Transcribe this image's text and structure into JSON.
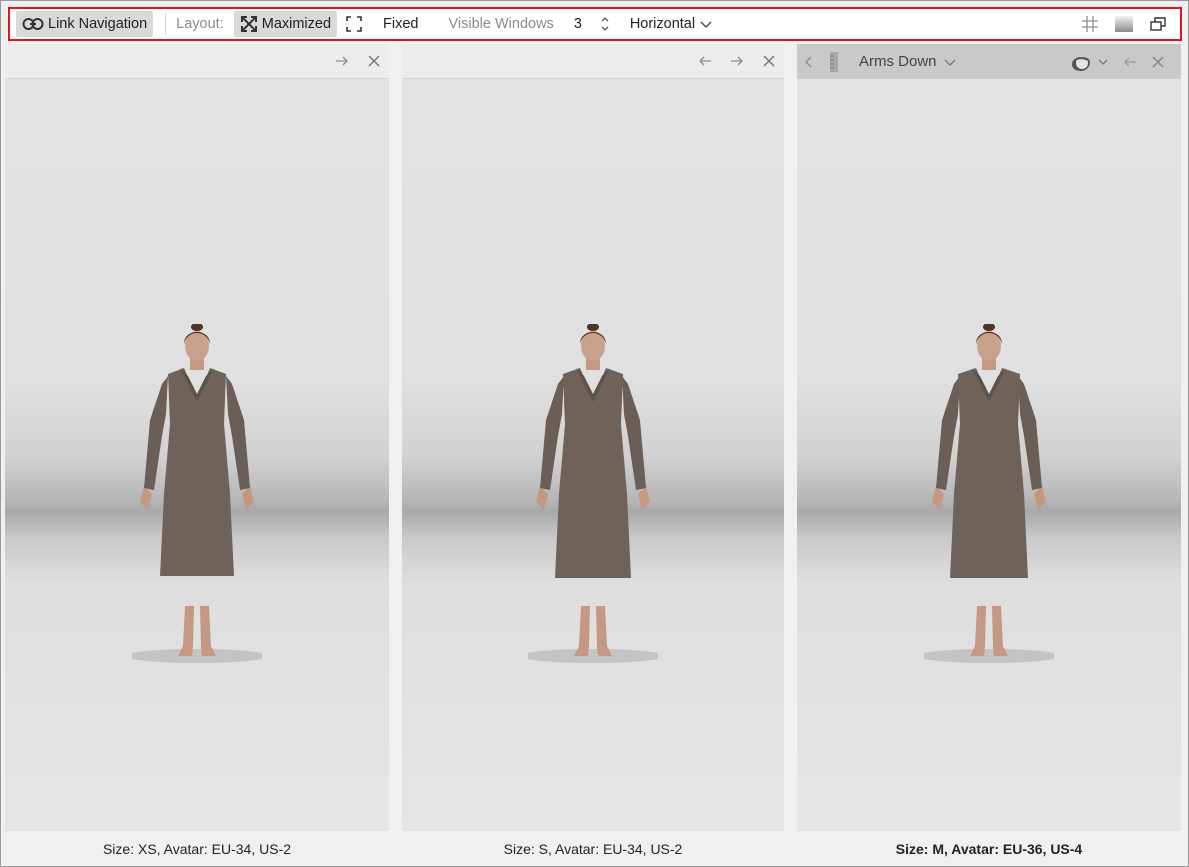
{
  "toolbar": {
    "link_navigation": "Link Navigation",
    "layout_label": "Layout:",
    "maximized": "Maximized",
    "fixed": "Fixed",
    "visible_windows_label": "Visible Windows",
    "visible_windows_value": "3",
    "orientation": "Horizontal",
    "icons": [
      "link-icon",
      "maximize-icon",
      "fixed-frame-icon",
      "stepper-icon",
      "chevron-down-icon",
      "grid-icon",
      "background-icon",
      "restore-window-icon"
    ]
  },
  "panels": [
    {
      "caption": "Size: XS, Avatar: EU-34, US-2",
      "header_icons": [
        "arrow-right-icon",
        "close-icon"
      ]
    },
    {
      "caption": "Size: S, Avatar: EU-34, US-2",
      "header_icons": [
        "arrow-left-icon",
        "arrow-right-icon",
        "close-icon"
      ]
    },
    {
      "caption": "Size: M, Avatar: EU-36, US-4",
      "pose": "Arms Down",
      "header_icons": [
        "chevron-left-icon",
        "ruler-icon",
        "chevron-down-icon",
        "avatar-head-icon",
        "chevron-down-icon",
        "arrow-left-icon",
        "close-icon"
      ]
    }
  ],
  "colors": {
    "highlight_border": "#e0141e",
    "dress": "#6e625a",
    "active_button": "#d9d9d9"
  }
}
